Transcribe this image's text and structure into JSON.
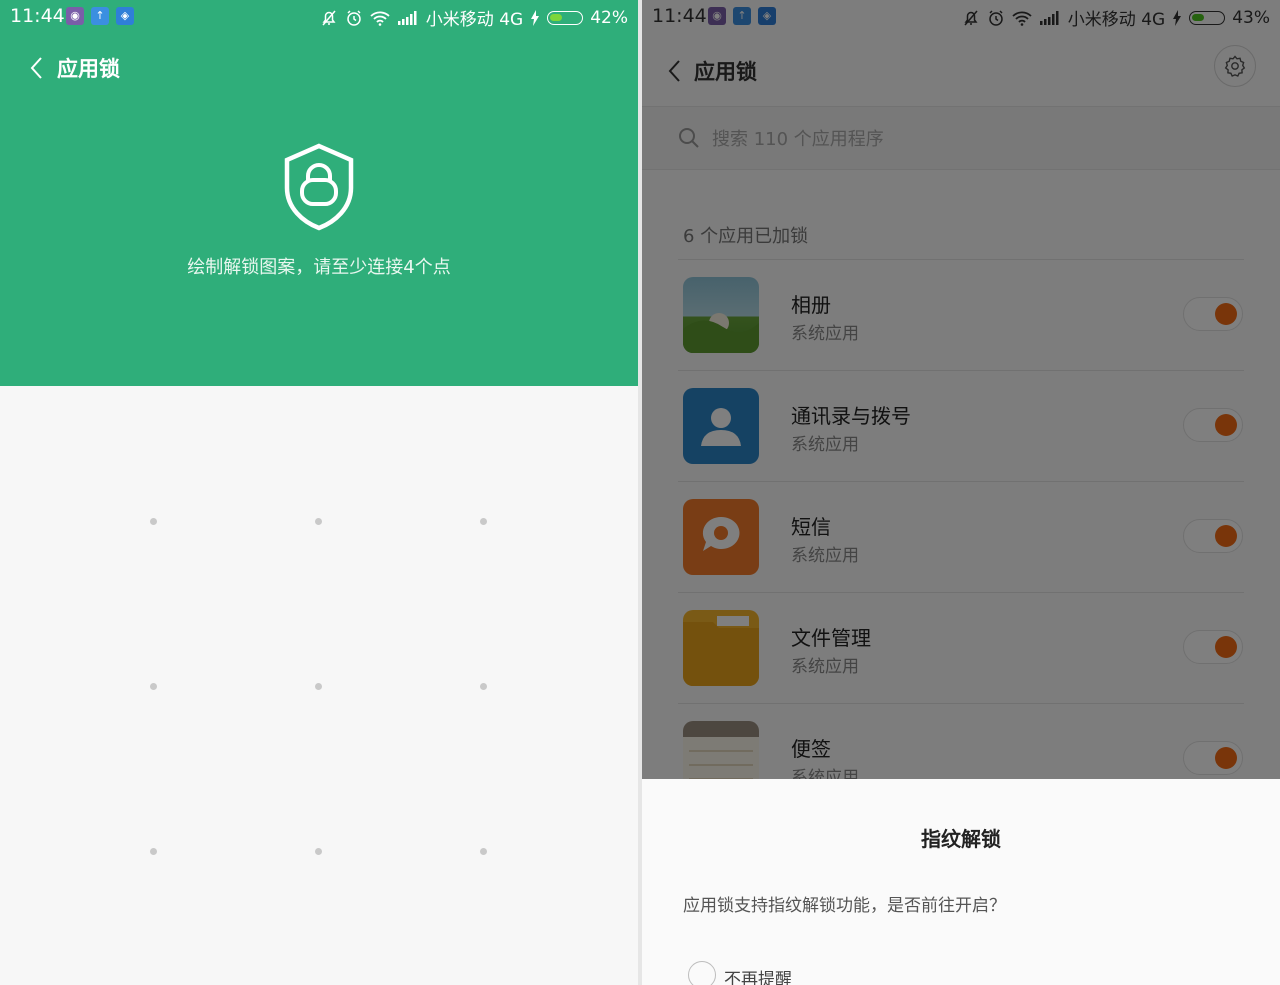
{
  "left": {
    "status": {
      "time": "11:44",
      "carrier": "小米移动 4G",
      "battery": "42%",
      "battery_level": 0.42
    },
    "title": "应用锁",
    "hint": "绘制解锁图案，请至少连接4个点"
  },
  "right": {
    "status": {
      "time": "11:44",
      "carrier": "小米移动 4G",
      "battery": "43%",
      "battery_level": 0.43
    },
    "title": "应用锁",
    "search_placeholder": "搜索 110 个应用程序",
    "locked_count_label": "6 个应用已加锁",
    "apps": [
      {
        "name": "相册",
        "sub": "系统应用",
        "icon": "gallery-icon",
        "locked": true
      },
      {
        "name": "通讯录与拨号",
        "sub": "系统应用",
        "icon": "contacts-icon",
        "locked": true
      },
      {
        "name": "短信",
        "sub": "系统应用",
        "icon": "messages-icon",
        "locked": true
      },
      {
        "name": "文件管理",
        "sub": "系统应用",
        "icon": "folder-icon",
        "locked": true
      },
      {
        "name": "便签",
        "sub": "系统应用",
        "icon": "notes-icon",
        "locked": true
      }
    ],
    "dialog": {
      "title": "指纹解锁",
      "message": "应用锁支持指纹解锁功能，是否前往开启？",
      "checkbox_label": "不再提醒"
    }
  },
  "colors": {
    "header_green": "#2fae7a",
    "toggle_on": "#f36b15"
  }
}
